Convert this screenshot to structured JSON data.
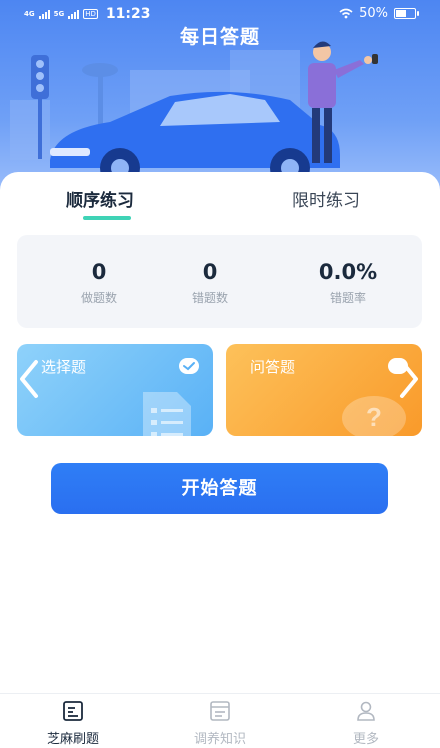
{
  "status_bar": {
    "network1": "4G",
    "network2": "5G",
    "hd": "HD",
    "time": "11:23",
    "battery": "50%"
  },
  "header": {
    "title": "每日答题"
  },
  "tabs": [
    {
      "label": "顺序练习",
      "active": true
    },
    {
      "label": "限时练习",
      "active": false
    }
  ],
  "stats": [
    {
      "value": "0",
      "label": "做题数"
    },
    {
      "value": "0",
      "label": "错题数"
    },
    {
      "value": "0.0%",
      "label": "错题率"
    }
  ],
  "question_types": [
    {
      "label": "选择题",
      "selected": true
    },
    {
      "label": "问答题",
      "selected": false
    }
  ],
  "start_button": {
    "label": "开始答题"
  },
  "bottom_nav": [
    {
      "label": "芝麻刷题",
      "icon": "list-doc-icon",
      "active": true
    },
    {
      "label": "调养知识",
      "icon": "note-icon",
      "active": false
    },
    {
      "label": "更多",
      "icon": "person-icon",
      "active": false
    }
  ],
  "colors": {
    "primary": "#2f7ef6",
    "tab_indicator": "#3fd3b6",
    "choice_card": "#59b1f6",
    "qa_card": "#f99a2a"
  }
}
